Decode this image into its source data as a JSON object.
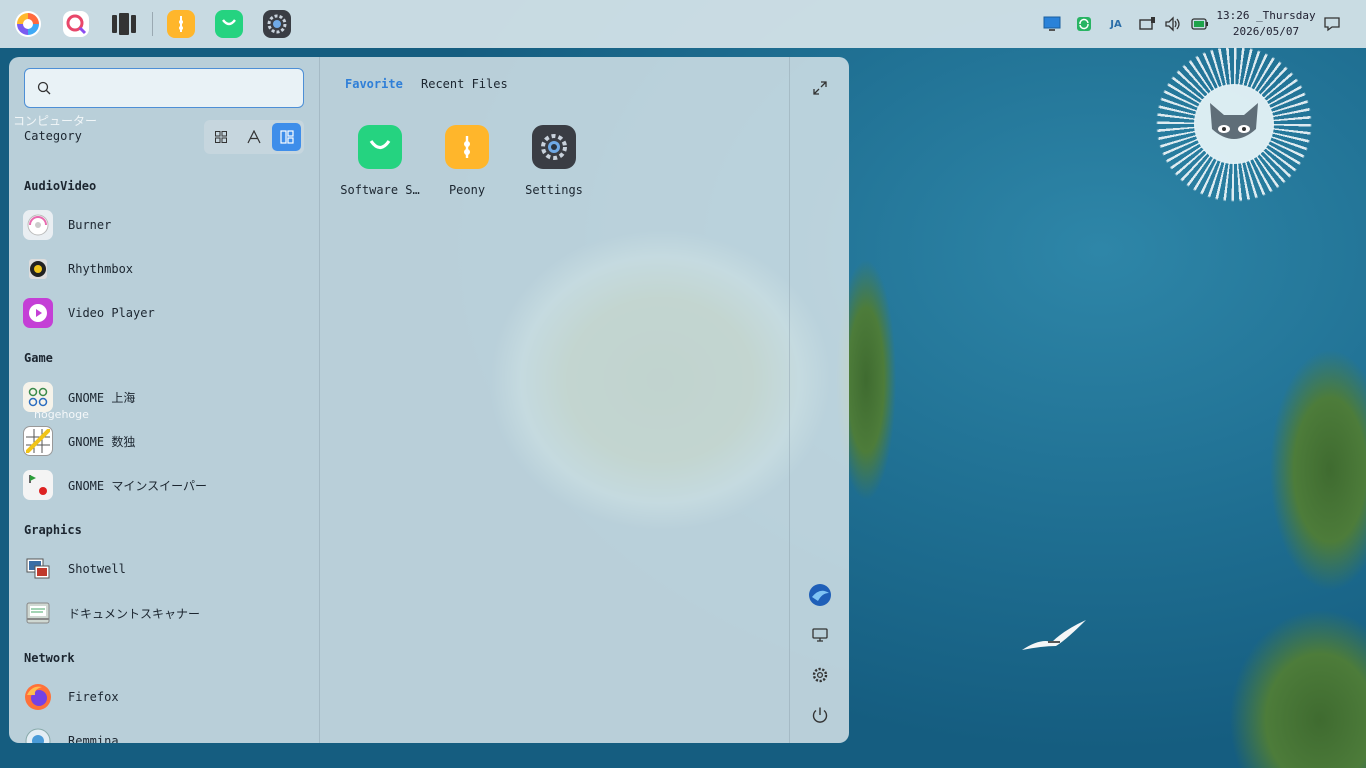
{
  "dock": {
    "apps": [
      {
        "name": "launcher",
        "icon": "launcher-icon"
      },
      {
        "name": "search",
        "icon": "search-app-icon"
      },
      {
        "name": "multitask",
        "icon": "multitask-icon"
      },
      {
        "name": "peony",
        "icon": "peony-icon"
      },
      {
        "name": "software-store",
        "icon": "software-store-icon"
      },
      {
        "name": "settings",
        "icon": "settings-icon"
      }
    ]
  },
  "tray": {
    "ime_label": "JA"
  },
  "clock": {
    "time": "13:26 _Thursday",
    "date": "2026/05/07"
  },
  "launcher": {
    "search": {
      "value": "",
      "placeholder": ""
    },
    "ghost_label": "コンピューター",
    "category_title": "Category",
    "view_modes": [
      "grid",
      "letter",
      "category"
    ],
    "groups": [
      {
        "title": "AudioVideo",
        "apps": [
          "Burner",
          "Rhythmbox",
          "Video Player"
        ]
      },
      {
        "title": "Game",
        "apps": [
          "GNOME 上海",
          "GNOME 数独",
          "GNOME マインスイーパー"
        ]
      },
      {
        "title": "Graphics",
        "apps": [
          "Shotwell",
          "ドキュメントスキャナー"
        ]
      },
      {
        "title": "Network",
        "apps": [
          "Firefox",
          "Remmina"
        ]
      }
    ],
    "desktop_folder_label": "nogehoge",
    "tabs": {
      "favorite": "Favorite",
      "recent": "Recent Files"
    },
    "favorites": [
      "Software S…",
      "Peony",
      "Settings"
    ]
  },
  "colors": {
    "accent": "#3f8eea",
    "panel": "#d4e2e8"
  }
}
